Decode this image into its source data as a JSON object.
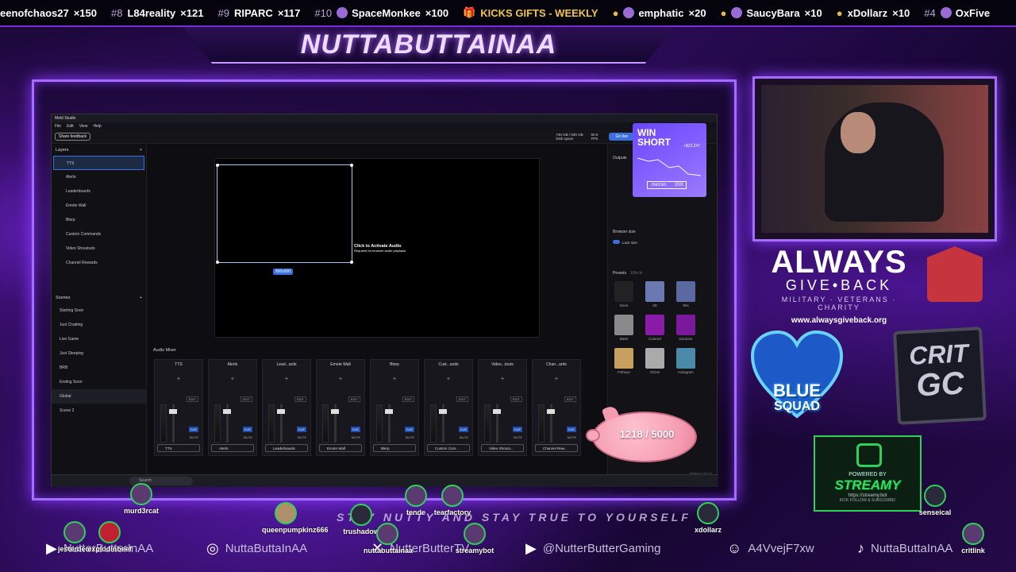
{
  "ticker": {
    "items": [
      {
        "rank": "",
        "name": "eenofchaos27",
        "count": "×150"
      },
      {
        "rank": "#8",
        "name": "L84reality",
        "count": "×121"
      },
      {
        "rank": "#9",
        "name": "RIPARC",
        "count": "×117"
      },
      {
        "rank": "#10",
        "name": "SpaceMonkee",
        "count": "×100"
      }
    ],
    "gifts_label": "KICKS GIFTS - WEEKLY",
    "gifts": [
      {
        "name": "emphatic",
        "count": "×20"
      },
      {
        "name": "SaucyBara",
        "count": "×10"
      },
      {
        "name": "xDollarz",
        "count": "×10"
      },
      {
        "rank": "#4",
        "name": "OxFive",
        "count": ""
      }
    ]
  },
  "header": {
    "title": "NUTTABUTTAINAA"
  },
  "app": {
    "window_title": "Meld Studio",
    "menu": [
      "File",
      "Edit",
      "View",
      "Help"
    ],
    "share_feedback": "Share feedback",
    "disk": "730 GB / 930 GB",
    "disk_label": "Disk space",
    "fps": "60.0",
    "fps_label": "FPS",
    "go_live": "Go live",
    "layers_title": "Layers",
    "layers": [
      "TTS",
      "Alerts",
      "Leaderboards",
      "Emote Wall",
      "Blerp",
      "Custom Commands",
      "Video Shoutouts",
      "Channel Rewards"
    ],
    "scenes_title": "Scenes",
    "scenes": [
      "Starting Soon",
      "Just Chatting",
      "Live Game",
      "Just Sleeping",
      "BRB",
      "Ending Soon",
      "Global",
      "Scene 2"
    ],
    "canvas_size": "800x600",
    "activate_audio": "Click to Activate Audio",
    "activate_sub": "Required for browser audio playback",
    "mixer_title": "Audio Mixer",
    "channels": [
      {
        "name": "TTS",
        "source": "TTS"
      },
      {
        "name": "Alerts",
        "source": "Alerts"
      },
      {
        "name": "Lead...ards",
        "source": "Leaderboards"
      },
      {
        "name": "Emote Wall",
        "source": "Emote Wall"
      },
      {
        "name": "Blerp",
        "source": "Blerp"
      },
      {
        "name": "Cust...ands",
        "source": "Custom Com..."
      },
      {
        "name": "Video...touts",
        "source": "Video Shouto..."
      },
      {
        "name": "Chan...ards",
        "source": "Channel Rew..."
      }
    ],
    "outputs": "Outputs",
    "browser_size": "Browser size",
    "lock_size": "Lock size",
    "presets": "Presets",
    "effects": "Effects",
    "preset_labels": [
      "None",
      "3D",
      "90s",
      "B&W",
      "Colored",
      "Duotone",
      "Fisheye",
      "Ghost",
      "Hologram"
    ],
    "version": "Version 0.10.3.2",
    "search": "Search"
  },
  "win_short": {
    "title": "WIN SHORT",
    "amount": "+$22,247",
    "brand": ".micron.",
    "badge": "20X"
  },
  "piggy": {
    "progress": "1218 / 5000",
    "current": 1218,
    "goal": 5000
  },
  "branding": {
    "always": "ALWAYS",
    "give_back": "GIVE•BACK",
    "mission": "MILITARY · VETERANS · CHARITY",
    "url": "www.alwaysgiveback.org",
    "blue": "BLUE",
    "squad": "SQUAD",
    "crit": "CRIT",
    "gc": "GC"
  },
  "streamy": {
    "powered": "POWERED BY",
    "name": "STREAMY",
    "url": "https://streamy.bot",
    "kick": "KICK  FOLLOW & SUBSCRIBE!"
  },
  "tagline": "STAY NUTTY AND STAY TRUE TO YOURSELF",
  "socials": [
    {
      "icon": "kick-icon",
      "handle": "NutterButterInAA"
    },
    {
      "icon": "instagram-icon",
      "handle": "NuttaButtaInAA"
    },
    {
      "icon": "x-icon",
      "handle": "NutterButterTV"
    },
    {
      "icon": "youtube-icon",
      "handle": "@NutterButterGaming"
    },
    {
      "icon": "discord-icon",
      "handle": "A4VvejF7xw"
    },
    {
      "icon": "tiktok-icon",
      "handle": "NuttaButtaInAA"
    }
  ],
  "chatters": [
    "murd3rcat",
    "queenpumpkinz666",
    "trushadow",
    "tende",
    "tearfactory",
    "xdollarz",
    "senseical",
    "jesterdeci",
    "explodinbeef",
    "nuttabuttainaa",
    "streamybot",
    "critlink"
  ]
}
